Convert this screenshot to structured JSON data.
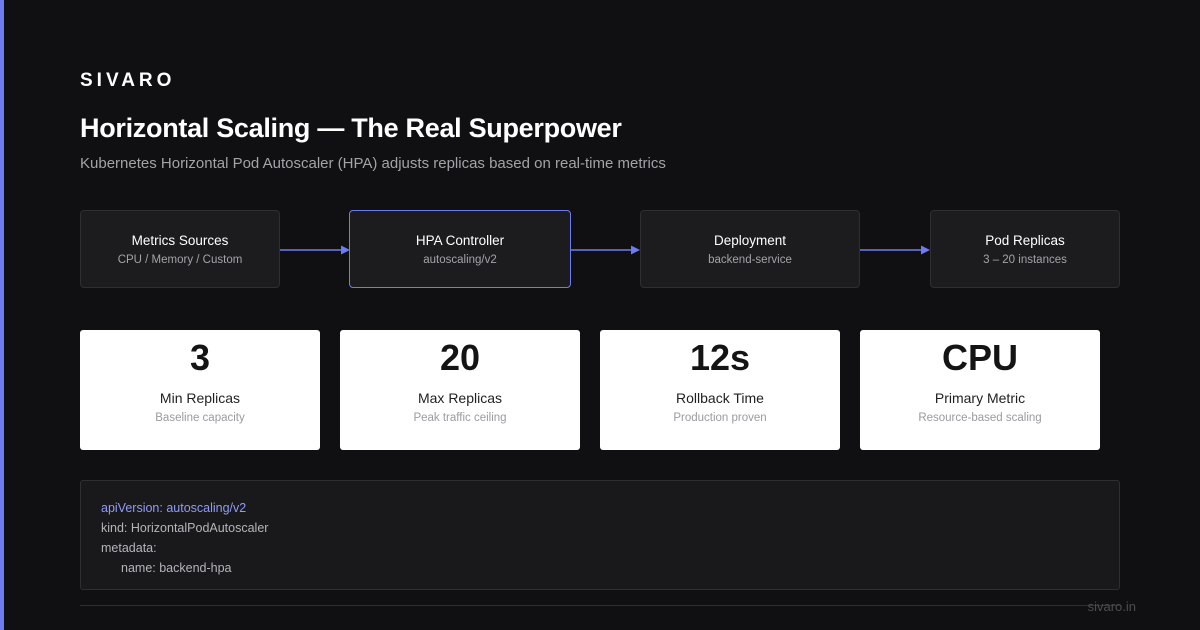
{
  "brand": "SIVARO",
  "title": "Horizontal Scaling — The Real Superpower",
  "subtitle": "Kubernetes Horizontal Pod Autoscaler (HPA) adjusts replicas based on real-time metrics",
  "flow": [
    {
      "title": "Metrics Sources",
      "sub": "CPU / Memory / Custom"
    },
    {
      "title": "HPA Controller",
      "sub": "autoscaling/v2"
    },
    {
      "title": "Deployment",
      "sub": "backend-service"
    },
    {
      "title": "Pod Replicas",
      "sub": "3 – 20 instances"
    }
  ],
  "stats": [
    {
      "value": "3",
      "label": "Min Replicas",
      "sub": "Baseline capacity"
    },
    {
      "value": "20",
      "label": "Max Replicas",
      "sub": "Peak traffic ceiling"
    },
    {
      "value": "12s",
      "label": "Rollback Time",
      "sub": "Production proven"
    },
    {
      "value": "CPU",
      "label": "Primary Metric",
      "sub": "Resource-based scaling"
    }
  ],
  "code": [
    "apiVersion: autoscaling/v2",
    "kind: HorizontalPodAutoscaler",
    "metadata:",
    "name: backend-hpa"
  ],
  "footer": "sivaro.in",
  "colors": {
    "accent": "#6d7cf3",
    "background": "#101012",
    "card": "#ffffff"
  }
}
